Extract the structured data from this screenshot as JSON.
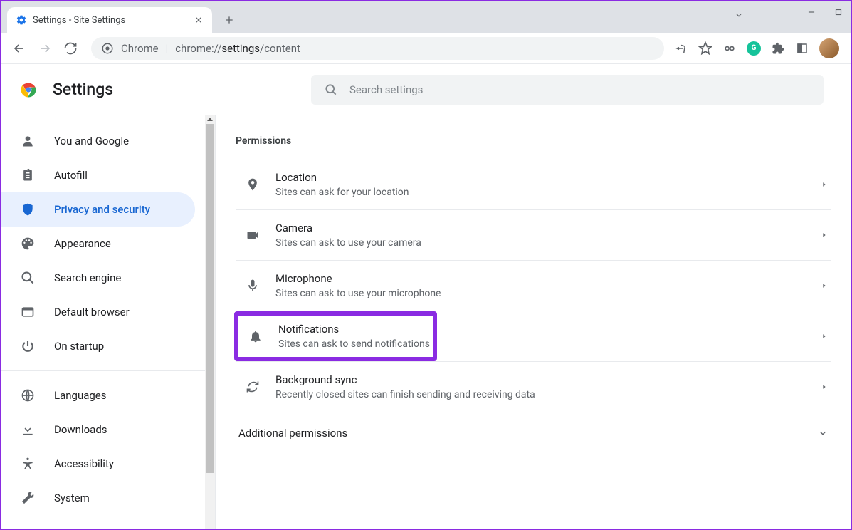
{
  "tab": {
    "title": "Settings - Site Settings"
  },
  "url": {
    "prefix": "Chrome",
    "path_light": "chrome://",
    "path_dark": "settings",
    "path_tail": "/content"
  },
  "header": {
    "title": "Settings",
    "search_placeholder": "Search settings"
  },
  "sidebar": {
    "items": [
      {
        "label": "You and Google",
        "icon": "person"
      },
      {
        "label": "Autofill",
        "icon": "clipboard"
      },
      {
        "label": "Privacy and security",
        "icon": "shield",
        "active": true
      },
      {
        "label": "Appearance",
        "icon": "palette"
      },
      {
        "label": "Search engine",
        "icon": "search"
      },
      {
        "label": "Default browser",
        "icon": "browser"
      },
      {
        "label": "On startup",
        "icon": "power"
      }
    ],
    "items2": [
      {
        "label": "Languages",
        "icon": "globe"
      },
      {
        "label": "Downloads",
        "icon": "download"
      },
      {
        "label": "Accessibility",
        "icon": "accessibility"
      },
      {
        "label": "System",
        "icon": "wrench"
      }
    ]
  },
  "content": {
    "section_title": "Permissions",
    "permissions": [
      {
        "title": "Location",
        "desc": "Sites can ask for your location",
        "icon": "location"
      },
      {
        "title": "Camera",
        "desc": "Sites can ask to use your camera",
        "icon": "camera"
      },
      {
        "title": "Microphone",
        "desc": "Sites can ask to use your microphone",
        "icon": "mic"
      },
      {
        "title": "Notifications",
        "desc": "Sites can ask to send notifications",
        "icon": "bell",
        "highlighted": true
      },
      {
        "title": "Background sync",
        "desc": "Recently closed sites can finish sending and receiving data",
        "icon": "sync"
      }
    ],
    "additional": "Additional permissions"
  }
}
